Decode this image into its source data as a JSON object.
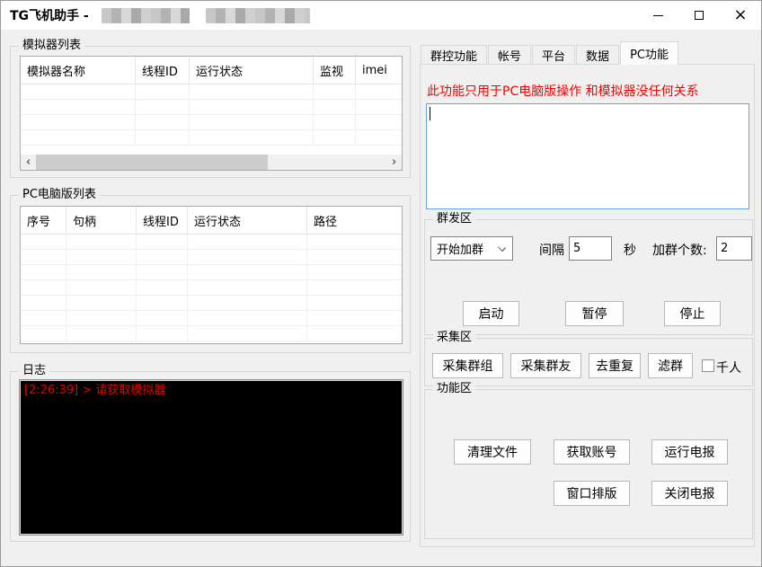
{
  "window": {
    "title": "TG飞机助手 -",
    "controls": {
      "close_glyph": "×"
    }
  },
  "icons": {
    "scrollbar_left": "‹",
    "scrollbar_right": "›"
  },
  "colors": {
    "window_bg": "#f0f0f0",
    "titlebar_bg": "#ffffff",
    "warning_red": "#f50000",
    "log_red": "#e30000",
    "console_bg": "#000000",
    "focus_blue_border": "#64a2e3"
  },
  "left": {
    "emulator_group": {
      "title": "模拟器列表",
      "columns": [
        "模拟器名称",
        "线程ID",
        "运行状态",
        "监视",
        "imei"
      ],
      "rows": []
    },
    "pc_group": {
      "title": "PC电脑版列表",
      "columns": [
        "序号",
        "句柄",
        "线程ID",
        "运行状态",
        "路径"
      ],
      "rows": []
    },
    "log_group": {
      "title": "日志",
      "entries": [
        "[2:26:39] > 请获取模拟器"
      ]
    }
  },
  "right": {
    "tabs": [
      {
        "label": "群控功能",
        "active": false
      },
      {
        "label": "帐号",
        "active": false
      },
      {
        "label": "平台",
        "active": false
      },
      {
        "label": "数据",
        "active": false
      },
      {
        "label": "PC功能",
        "active": true
      }
    ],
    "warning": "此功能只用于PC电脑版操作  和模拟器没任何关系",
    "textarea_value": "",
    "mass_group": {
      "title": "群发区",
      "action_select": {
        "value": "开始加群"
      },
      "interval_label": "间隔",
      "interval_value": "5",
      "seconds_label": "秒",
      "join_count_label": "加群个数:",
      "join_count_value": "2",
      "buttons": {
        "start": "启动",
        "pause": "暂停",
        "stop": "停止"
      }
    },
    "collect_group": {
      "title": "采集区",
      "buttons": [
        "采集群组",
        "采集群友",
        "去重复",
        "滤群"
      ],
      "checkbox_label": "千人",
      "checkbox_checked": false
    },
    "function_group": {
      "title": "功能区",
      "buttons": [
        "清理文件",
        "获取账号",
        "运行电报",
        "窗口排版",
        "关闭电报"
      ]
    }
  }
}
